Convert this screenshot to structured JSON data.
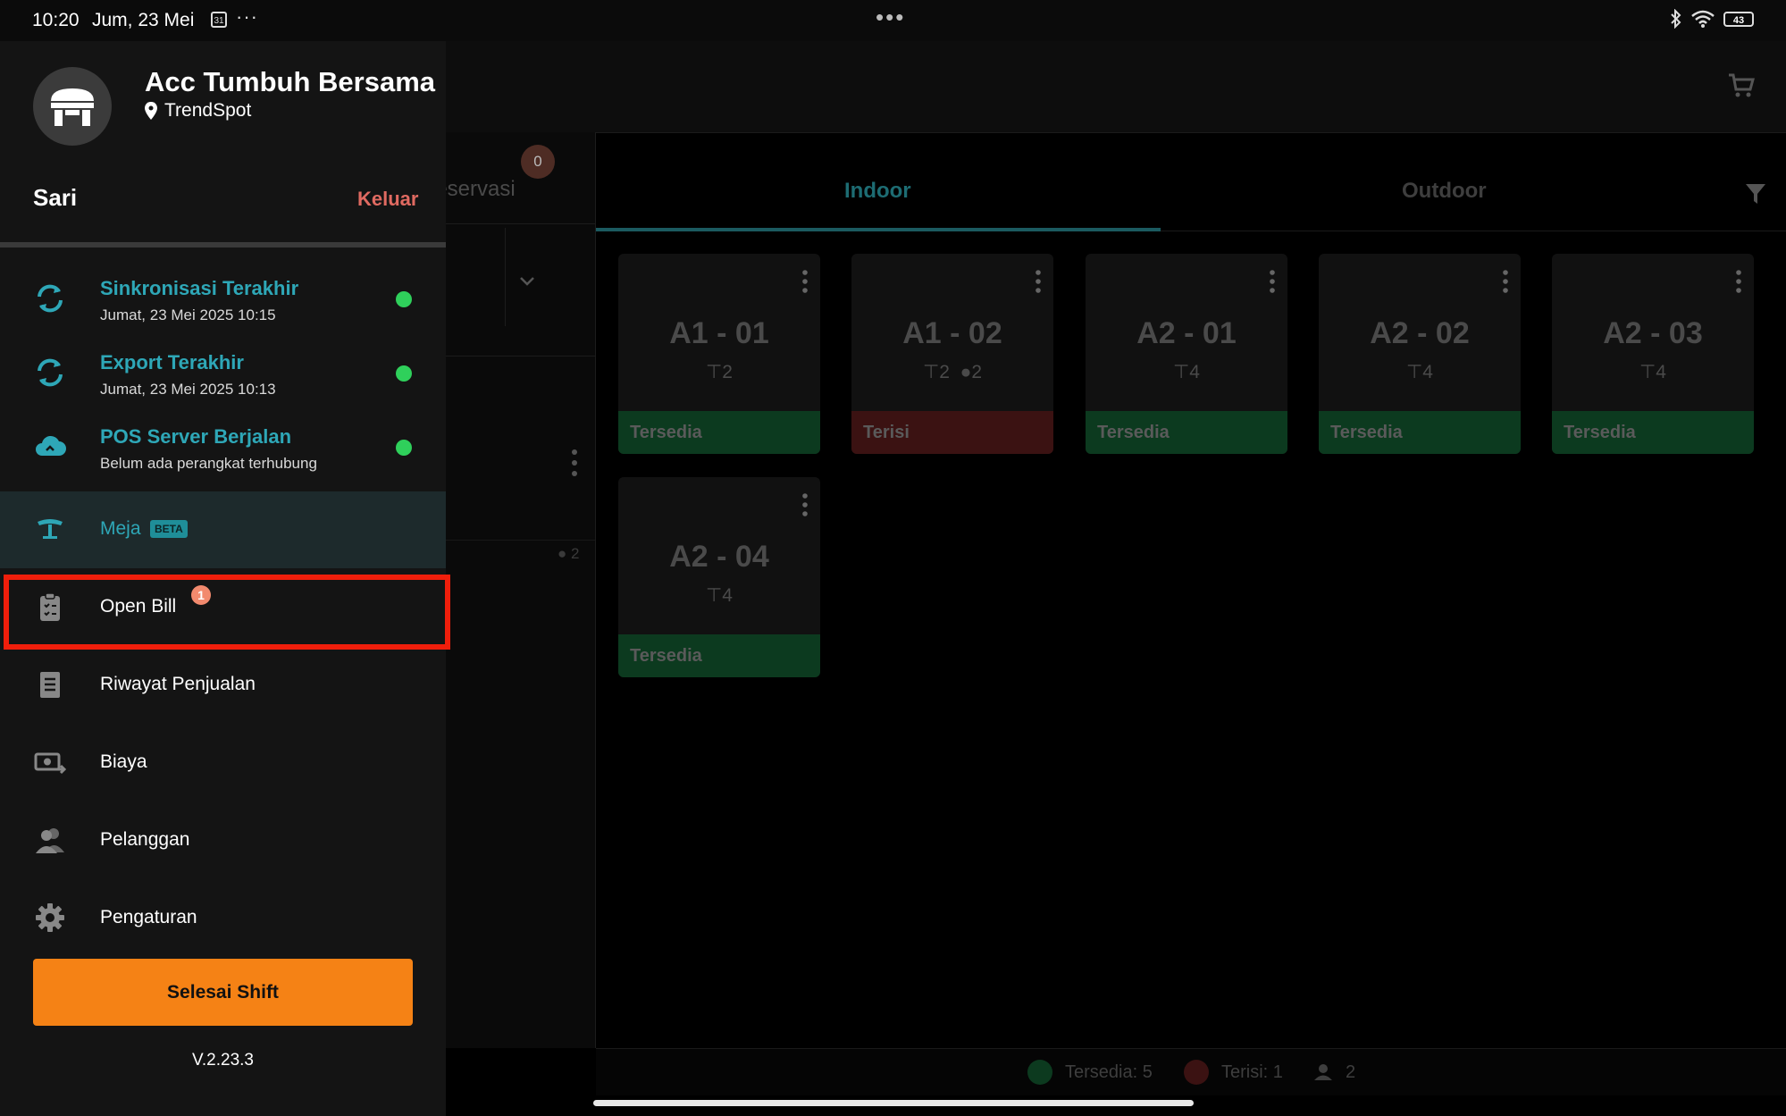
{
  "status_bar": {
    "time": "10:20",
    "date": "Jum, 23 Mei",
    "calendar_day": "31",
    "overflow": "···",
    "center_dots": "•••",
    "battery": "43"
  },
  "header": {
    "tabs": [
      {
        "label": "Reservasi",
        "badge": "0"
      },
      {
        "label": "Indoor",
        "active": true
      },
      {
        "label": "Outdoor",
        "active": false
      }
    ]
  },
  "left_panel": {
    "guest_count": "2"
  },
  "tables": [
    {
      "name": "A1 - 01",
      "seats": "2",
      "guests": "",
      "status": "Tersedia",
      "status_color": "#0c3a1f"
    },
    {
      "name": "A1 - 02",
      "seats": "2",
      "guests": "2",
      "status": "Terisi",
      "status_color": "#3b1212"
    },
    {
      "name": "A2 - 01",
      "seats": "4",
      "guests": "",
      "status": "Tersedia",
      "status_color": "#0c3a1f"
    },
    {
      "name": "A2 - 02",
      "seats": "4",
      "guests": "",
      "status": "Tersedia",
      "status_color": "#0c3a1f"
    },
    {
      "name": "A2 - 03",
      "seats": "4",
      "guests": "",
      "status": "Tersedia",
      "status_color": "#0c3a1f"
    },
    {
      "name": "A2 - 04",
      "seats": "4",
      "guests": "",
      "status": "Tersedia",
      "status_color": "#0c3a1f"
    }
  ],
  "footer": {
    "available": "Tersedia: 5",
    "occupied": "Terisi: 1",
    "guests": "2"
  },
  "drawer": {
    "store_name": "Acc Tumbuh Bersama",
    "store_location": "TrendSpot",
    "user_name": "Sari",
    "logout_label": "Keluar",
    "sync": [
      {
        "title": "Sinkronisasi Terakhir",
        "subtitle": "Jumat, 23 Mei 2025 10:15",
        "icon": "sync-icon"
      },
      {
        "title": "Export Terakhir",
        "subtitle": "Jumat, 23 Mei 2025 10:13",
        "icon": "export-icon"
      },
      {
        "title": "POS Server Berjalan",
        "subtitle": "Belum ada perangkat terhubung",
        "icon": "cloud-server-icon"
      }
    ],
    "menu": [
      {
        "label": "Meja",
        "tag": "BETA",
        "icon": "table-icon",
        "active": true
      },
      {
        "label": "Open Bill",
        "badge": "1",
        "icon": "clipboard-icon"
      },
      {
        "label": "Riwayat Penjualan",
        "icon": "receipt-icon"
      },
      {
        "label": "Biaya",
        "icon": "expense-icon"
      },
      {
        "label": "Pelanggan",
        "icon": "customers-icon"
      },
      {
        "label": "Pengaturan",
        "icon": "gear-icon"
      }
    ],
    "end_shift_label": "Selesai Shift",
    "version": "V.2.23.3"
  },
  "colors": {
    "accent_teal": "#2ea7b7",
    "status_green": "#2fd05b",
    "end_shift_orange": "#f58215",
    "highlight_red": "#f01e0b"
  }
}
